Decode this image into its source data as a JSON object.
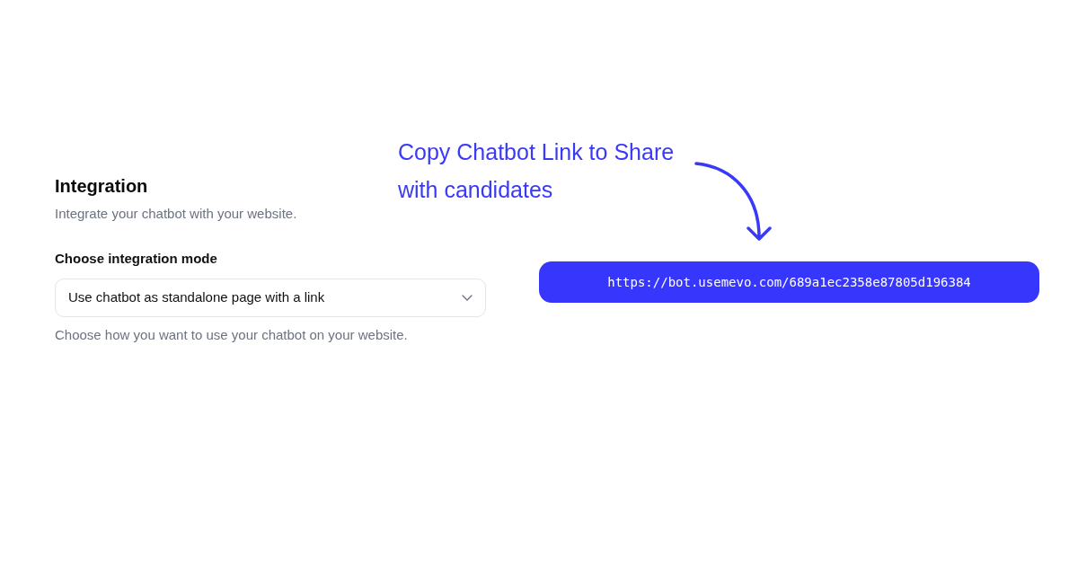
{
  "section": {
    "title": "Integration",
    "subtitle": "Integrate your chatbot with your website."
  },
  "integration_mode": {
    "label": "Choose integration mode",
    "value": "Use chatbot as standalone page with a link",
    "help_text": "Choose how you want to use your chatbot on your website."
  },
  "chatbot_link": {
    "url": "https://bot.usemevo.com/689a1ec2358e87805d196384"
  },
  "annotation": {
    "lines": [
      "Copy Chatbot Link to Share",
      "with candidates"
    ]
  }
}
